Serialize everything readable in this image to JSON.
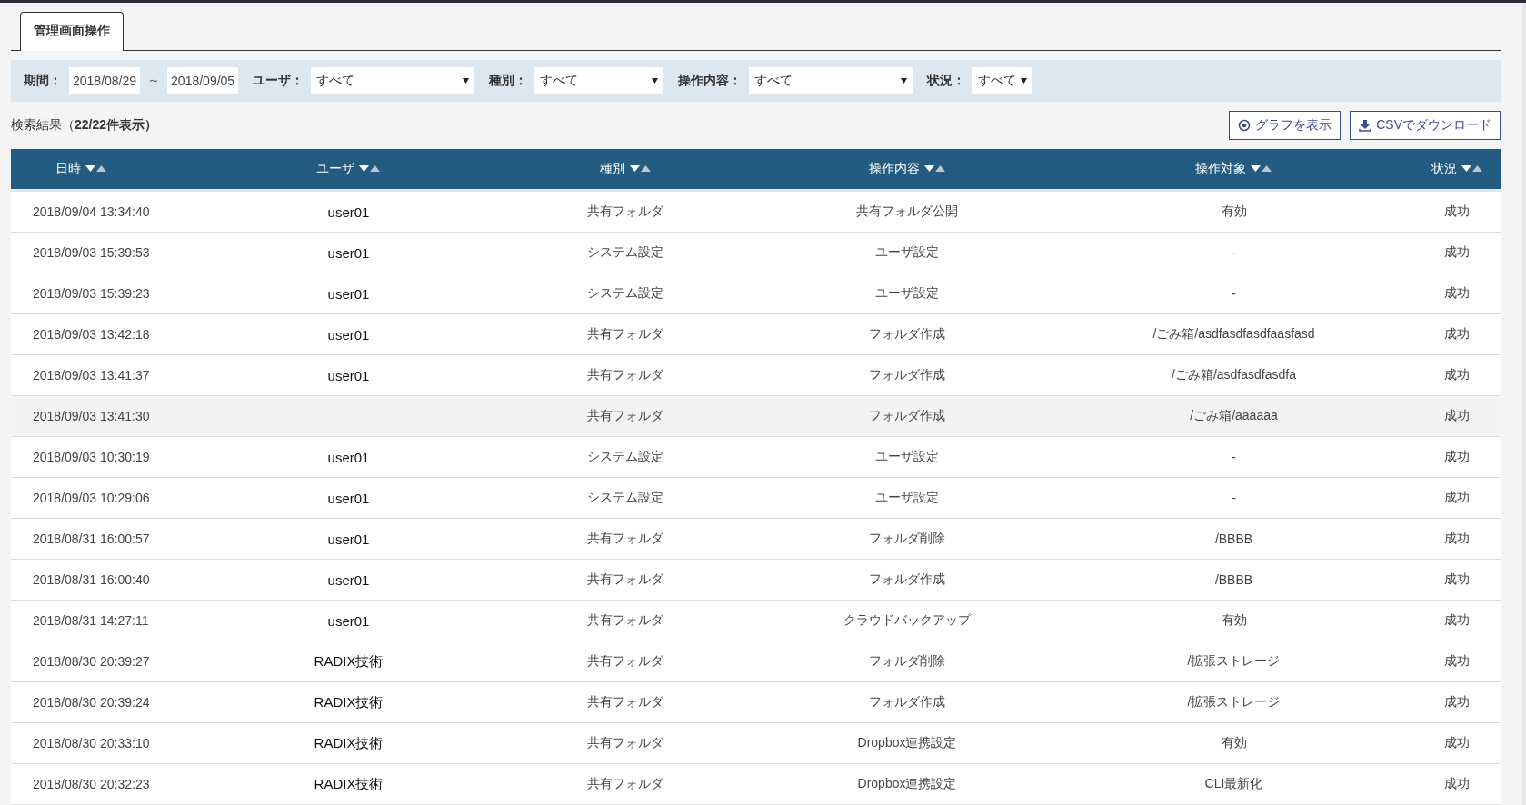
{
  "tabs": [
    {
      "label": "管理画面操作",
      "selected": true
    }
  ],
  "filters": {
    "period_label": "期間：",
    "date_from": "2018/08/29",
    "range_separator": "～",
    "date_to": "2018/09/05",
    "selects": [
      {
        "label": "ユーザ：",
        "value": "すべて"
      },
      {
        "label": "種別：",
        "value": "すべて"
      },
      {
        "label": "操作内容：",
        "value": "すべて"
      },
      {
        "label": "状況：",
        "value": "すべて"
      }
    ]
  },
  "result_summary": "検索結果（**22/22件表示）**",
  "buttons": [
    {
      "kind": "graph",
      "label": "グラフを表示"
    },
    {
      "kind": "download",
      "label": "CSVでダウンロード"
    }
  ],
  "table": {
    "columns": [
      "日時",
      "ユーザ",
      "種別",
      "操作内容",
      "操作対象",
      "状況"
    ],
    "rows": [
      {
        "cells": [
          "2018/09/04 13:34:40",
          "user01",
          "共有フォルダ",
          "共有フォルダ公開",
          "有効",
          "成功"
        ],
        "hovered": false
      },
      {
        "cells": [
          "2018/09/03 15:39:53",
          "user01",
          "システム設定",
          "ユーザ設定",
          "-",
          "成功"
        ],
        "hovered": false
      },
      {
        "cells": [
          "2018/09/03 15:39:23",
          "user01",
          "システム設定",
          "ユーザ設定",
          "-",
          "成功"
        ],
        "hovered": false
      },
      {
        "cells": [
          "2018/09/03 13:42:18",
          "user01",
          "共有フォルダ",
          "フォルダ作成",
          "/ごみ箱/asdfasdfasdfaasfasd",
          "成功"
        ],
        "hovered": false
      },
      {
        "cells": [
          "2018/09/03 13:41:37",
          "user01",
          "共有フォルダ",
          "フォルダ作成",
          "/ごみ箱/asdfasdfasdfa",
          "成功"
        ],
        "hovered": false
      },
      {
        "cells": [
          "2018/09/03 13:41:30",
          "",
          "共有フォルダ",
          "フォルダ作成",
          "/ごみ箱/aaaaaa",
          "成功"
        ],
        "hovered": true
      },
      {
        "cells": [
          "2018/09/03 10:30:19",
          "user01",
          "システム設定",
          "ユーザ設定",
          "-",
          "成功"
        ],
        "hovered": false
      },
      {
        "cells": [
          "2018/09/03 10:29:06",
          "user01",
          "システム設定",
          "ユーザ設定",
          "-",
          "成功"
        ],
        "hovered": false
      },
      {
        "cells": [
          "2018/08/31 16:00:57",
          "user01",
          "共有フォルダ",
          "フォルダ削除",
          "/BBBB",
          "成功"
        ],
        "hovered": false
      },
      {
        "cells": [
          "2018/08/31 16:00:40",
          "user01",
          "共有フォルダ",
          "フォルダ作成",
          "/BBBB",
          "成功"
        ],
        "hovered": false
      },
      {
        "cells": [
          "2018/08/31 14:27:11",
          "user01",
          "共有フォルダ",
          "クラウドバックアップ",
          "有効",
          "成功"
        ],
        "hovered": false
      },
      {
        "cells": [
          "2018/08/30 20:39:27",
          "RADIX技術",
          "共有フォルダ",
          "フォルダ削除",
          "/拡張ストレージ",
          "成功"
        ],
        "hovered": false
      },
      {
        "cells": [
          "2018/08/30 20:39:24",
          "RADIX技術",
          "共有フォルダ",
          "フォルダ作成",
          "/拡張ストレージ",
          "成功"
        ],
        "hovered": false
      },
      {
        "cells": [
          "2018/08/30 20:33:10",
          "RADIX技術",
          "共有フォルダ",
          "Dropbox連携設定",
          "有効",
          "成功"
        ],
        "hovered": false
      },
      {
        "cells": [
          "2018/08/30 20:32:23",
          "RADIX技術",
          "共有フォルダ",
          "Dropbox連携設定",
          "CLI最新化",
          "成功"
        ],
        "hovered": false
      }
    ]
  }
}
